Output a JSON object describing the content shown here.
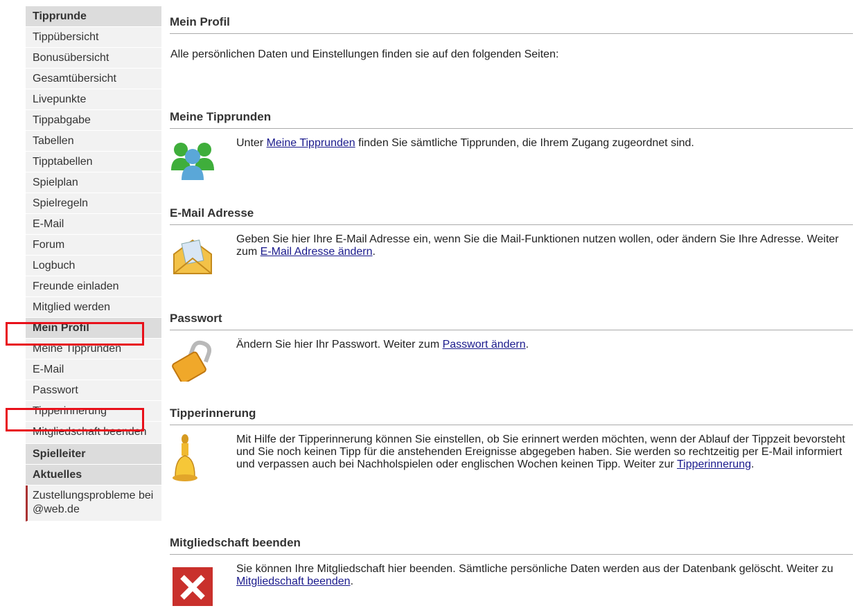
{
  "sidebar": {
    "group_tipprunde": "Tipprunde",
    "tipprunde_items": [
      "Tippübersicht",
      "Bonusübersicht",
      "Gesamtübersicht",
      "Livepunkte",
      "Tippabgabe",
      "Tabellen",
      "Tipptabellen",
      "Spielplan",
      "Spielregeln",
      "E-Mail",
      "Forum",
      "Logbuch",
      "Freunde einladen",
      "Mitglied werden"
    ],
    "group_profil": "Mein Profil",
    "profil_items": [
      "Meine Tipprunden",
      "E-Mail",
      "Passwort",
      "Tipperinnerung",
      "Mitgliedschaft beenden"
    ],
    "group_spielleiter": "Spielleiter",
    "group_aktuelles": "Aktuelles",
    "news_item": "Zustellungsprobleme bei @web.de"
  },
  "main": {
    "title": "Mein Profil",
    "intro": "Alle persönlichen Daten und Einstellungen finden sie auf den folgenden Seiten:",
    "sections": [
      {
        "title": "Meine Tipprunden",
        "icon": "users-icon",
        "before": "Unter ",
        "link": "Meine Tipprunden",
        "after": " finden Sie sämtliche Tipprunden, die Ihrem Zugang zugeordnet sind."
      },
      {
        "title": "E-Mail Adresse",
        "icon": "envelope-icon",
        "before": "Geben Sie hier Ihre E-Mail Adresse ein, wenn Sie die Mail-Funktionen nutzen wollen, oder ändern Sie Ihre Adresse. Weiter zum ",
        "link": "E-Mail Adresse ändern",
        "after": "."
      },
      {
        "title": "Passwort",
        "icon": "padlock-icon",
        "before": "Ändern Sie hier Ihr Passwort. Weiter zum ",
        "link": "Passwort ändern",
        "after": "."
      },
      {
        "title": "Tipperinnerung",
        "icon": "bell-icon",
        "before": "Mit Hilfe der Tipperinnerung können Sie einstellen, ob Sie erinnert werden möchten, wenn der Ablauf der Tippzeit bevorsteht und Sie noch keinen Tipp für die anstehenden Ereignisse abgegeben haben. Sie werden so rechtzeitig per E-Mail informiert und verpassen auch bei Nachholspielen oder englischen Wochen keinen Tipp. Weiter zur ",
        "link": "Tipperinnerung",
        "after": "."
      },
      {
        "title": "Mitgliedschaft beenden",
        "icon": "delete-x-icon",
        "before": "Sie können Ihre Mitgliedschaft hier beenden. Sämtliche persönliche Daten werden aus der Datenbank gelöscht. Weiter zu ",
        "link": "Mitgliedschaft beenden",
        "after": "."
      }
    ]
  },
  "colors": {
    "highlight": "#e8101a",
    "link": "#1a1a8c",
    "nav_header_bg": "#dcdcdc",
    "nav_item_bg": "#f2f2f2"
  }
}
